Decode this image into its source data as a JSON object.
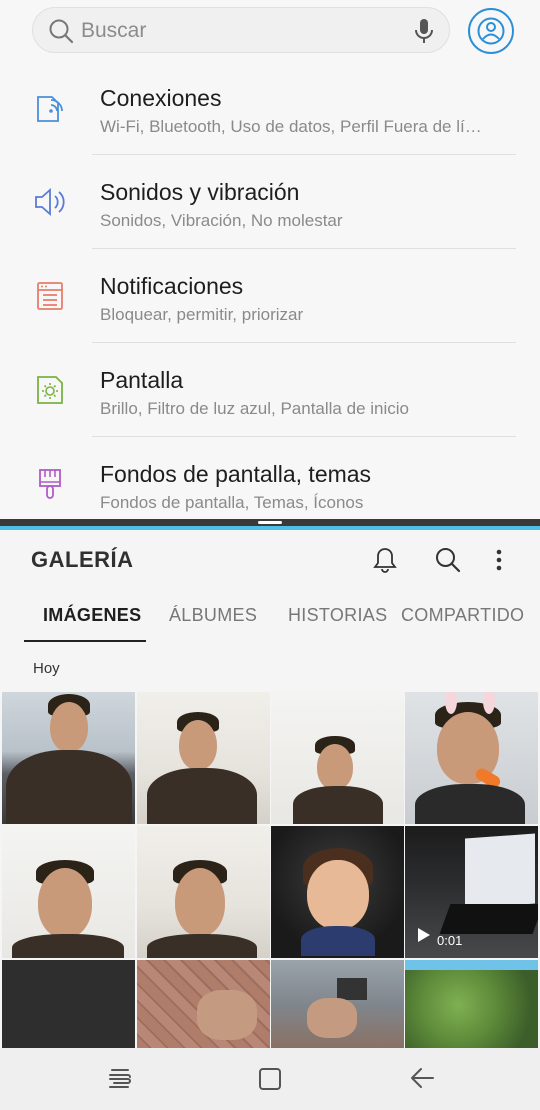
{
  "settings": {
    "search_placeholder": "Buscar",
    "items": [
      {
        "title": "Conexiones",
        "subtitle": "Wi-Fi, Bluetooth, Uso de datos, Perfil Fuera de lí…",
        "icon": "connections-icon",
        "color": "#4a90d9"
      },
      {
        "title": "Sonidos y vibración",
        "subtitle": "Sonidos, Vibración, No molestar",
        "icon": "speaker-icon",
        "color": "#5b7bd5"
      },
      {
        "title": "Notificaciones",
        "subtitle": "Bloquear, permitir, priorizar",
        "icon": "notifications-icon",
        "color": "#e57e6c"
      },
      {
        "title": "Pantalla",
        "subtitle": "Brillo, Filtro de luz azul, Pantalla de inicio",
        "icon": "display-icon",
        "color": "#7cb342"
      },
      {
        "title": "Fondos de pantalla, temas",
        "subtitle": "Fondos de pantalla, Temas, Íconos",
        "icon": "brush-icon",
        "color": "#b05cc6"
      }
    ]
  },
  "gallery": {
    "title": "GALERÍA",
    "tabs": [
      "IMÁGENES",
      "ÁLBUMES",
      "HISTORIAS",
      "COMPARTIDO"
    ],
    "active_tab": "IMÁGENES",
    "date_label": "Hoy",
    "video_duration": "0:01"
  },
  "colors": {
    "split_accent": "#4ebfe9",
    "account_icon": "#2b8fd6"
  }
}
